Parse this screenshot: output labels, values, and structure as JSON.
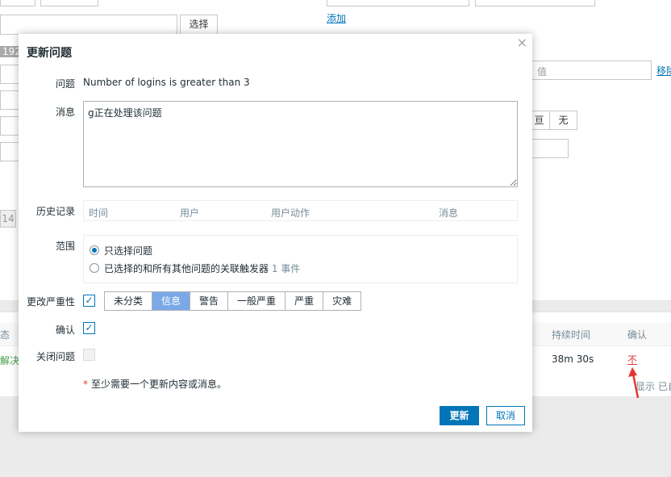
{
  "background": {
    "select_button": "选择",
    "add_link": "添加",
    "value_placeholder": "值",
    "remove_link": "移除",
    "toggle_partial": "亘",
    "none_button": "无",
    "tag_num_192": "192",
    "tag_num_14": "14",
    "table": {
      "col_status_partial": "态",
      "col_duration": "持续时间",
      "col_ack": "确认",
      "status_partial": "解决",
      "duration_value": "38m 30s",
      "ack_value": "不",
      "hint_partial": "显示 已自"
    }
  },
  "dialog": {
    "title": "更新问题",
    "close_glyph": "×",
    "problem_label": "问题",
    "problem_value": "Number of logins is greater than 3",
    "message_label": "消息",
    "message_value": "g正在处理该问题",
    "history_label": "历史记录",
    "history_columns": [
      "时间",
      "用户",
      "用户动作",
      "消息"
    ],
    "scope_label": "范围",
    "scope_option1": "只选择问题",
    "scope_option2": "已选择的和所有其他问题的关联触发器",
    "scope_option2_count": "1 事件",
    "severity_label": "更改严重性",
    "severity_checked_glyph": "✓",
    "severities": [
      "未分类",
      "信息",
      "警告",
      "一般严重",
      "严重",
      "灾难"
    ],
    "severity_selected": "信息",
    "ack_label": "确认",
    "ack_checked_glyph": "✓",
    "close_problem_label": "关闭问题",
    "required_star": "*",
    "required_note": "至少需要一个更新内容或消息。",
    "update_button": "更新",
    "cancel_button": "取消"
  },
  "colors": {
    "accent": "#0275b8",
    "severity_active": "#7aa9e8",
    "annotation_arrow": "#e33734"
  }
}
